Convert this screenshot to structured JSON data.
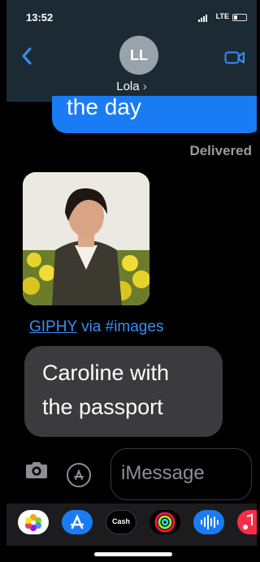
{
  "status_bar": {
    "time": "13:52",
    "network": "LTE"
  },
  "header": {
    "back_icon": "chevron-left-icon",
    "avatar_initials": "LL",
    "contact_name": "Lola",
    "video_icon": "video-camera-icon"
  },
  "messages": {
    "sent_text": "the day",
    "delivered_label": "Delivered",
    "gif_source_link": "GIPHY",
    "gif_via_text": "via #images",
    "received_lines": [
      "Caroline with",
      "the passport"
    ]
  },
  "input": {
    "placeholder": "iMessage"
  },
  "app_tray": {
    "apps": [
      {
        "name": "photos-icon"
      },
      {
        "name": "app-store-icon"
      },
      {
        "name": "apple-cash-icon",
        "label": "Cash"
      },
      {
        "name": "fitness-icon"
      },
      {
        "name": "audio-message-icon"
      },
      {
        "name": "music-icon"
      }
    ]
  }
}
